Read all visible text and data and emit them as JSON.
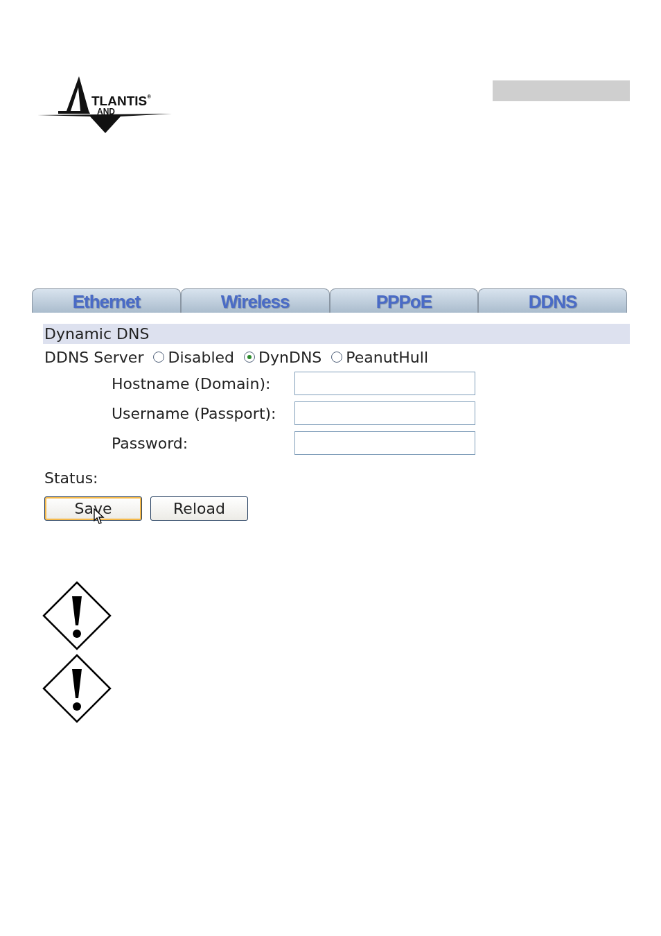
{
  "logo": {
    "text": "TLANTIS",
    "mark": "®",
    "sub": "AND"
  },
  "tabs": [
    {
      "label": "Ethernet",
      "selected": false
    },
    {
      "label": "Wireless",
      "selected": false
    },
    {
      "label": "PPPoE",
      "selected": false
    },
    {
      "label": "DDNS",
      "selected": false
    }
  ],
  "section_title": "Dynamic DNS",
  "ddns_server": {
    "label": "DDNS Server",
    "options": [
      {
        "label": "Disabled",
        "selected": false
      },
      {
        "label": "DynDNS",
        "selected": true
      },
      {
        "label": "PeanutHull",
        "selected": false
      }
    ]
  },
  "fields": [
    {
      "label": "Hostname (Domain):"
    },
    {
      "label": "Username (Passport):"
    },
    {
      "label": "Password:"
    }
  ],
  "status": {
    "label": "Status:"
  },
  "buttons": [
    {
      "label": "Save",
      "hovered": true
    },
    {
      "label": "Reload",
      "hovered": false
    }
  ],
  "warnings": [
    {
      "kind": "caution"
    },
    {
      "kind": "caution"
    }
  ]
}
